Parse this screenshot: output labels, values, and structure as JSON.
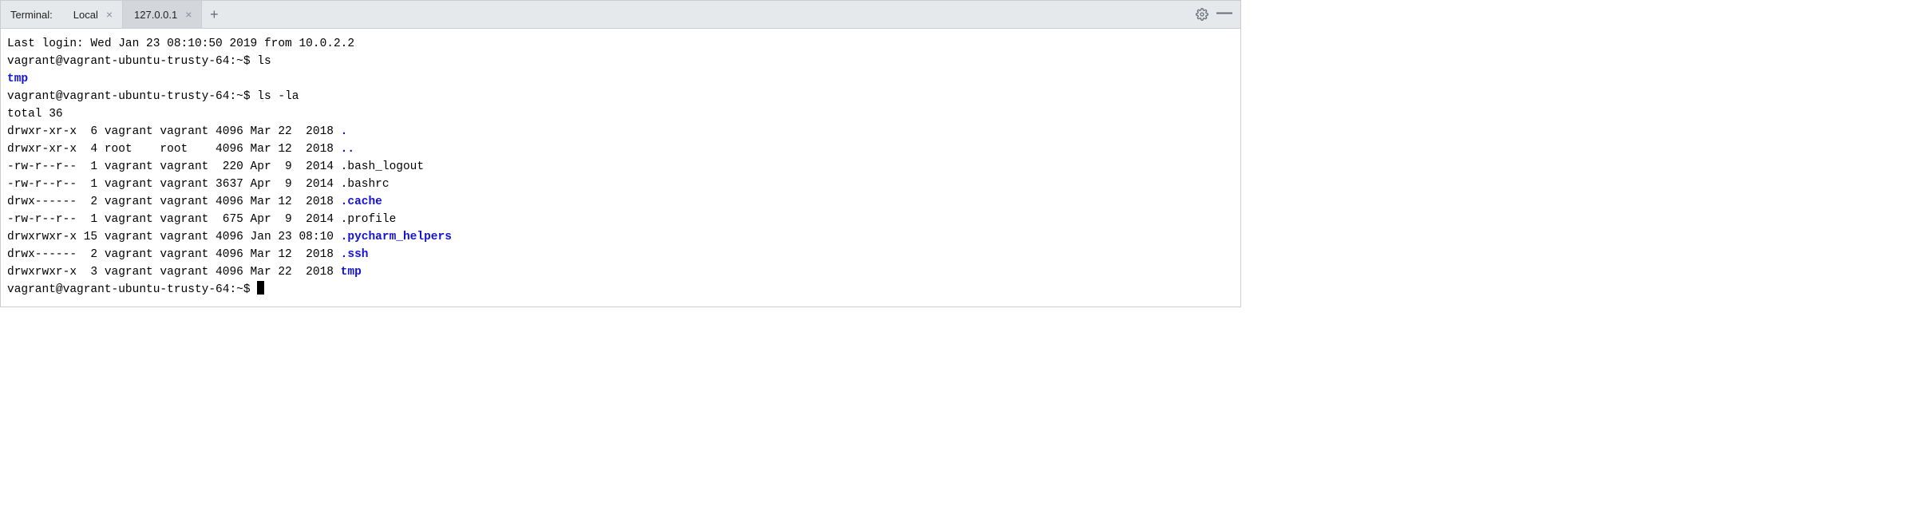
{
  "tabbar": {
    "title": "Terminal:",
    "tabs": [
      {
        "label": "Local",
        "active": false
      },
      {
        "label": "127.0.0.1",
        "active": true
      }
    ]
  },
  "terminal": {
    "last_login": "Last login: Wed Jan 23 08:10:50 2019 from 10.0.2.2",
    "prompt": "vagrant@vagrant-ubuntu-trusty-64:~$ ",
    "cmd1": "ls",
    "cmd1_out": "tmp",
    "cmd2": "ls -la",
    "total": "total 36",
    "listing": [
      {
        "pre": "drwxr-xr-x  6 vagrant vagrant 4096 Mar 22  2018 ",
        "name": ".",
        "dir": true
      },
      {
        "pre": "drwxr-xr-x  4 root    root    4096 Mar 12  2018 ",
        "name": "..",
        "dir": true
      },
      {
        "pre": "-rw-r--r--  1 vagrant vagrant  220 Apr  9  2014 ",
        "name": ".bash_logout",
        "dir": false
      },
      {
        "pre": "-rw-r--r--  1 vagrant vagrant 3637 Apr  9  2014 ",
        "name": ".bashrc",
        "dir": false
      },
      {
        "pre": "drwx------  2 vagrant vagrant 4096 Mar 12  2018 ",
        "name": ".cache",
        "dir": true
      },
      {
        "pre": "-rw-r--r--  1 vagrant vagrant  675 Apr  9  2014 ",
        "name": ".profile",
        "dir": false
      },
      {
        "pre": "drwxrwxr-x 15 vagrant vagrant 4096 Jan 23 08:10 ",
        "name": ".pycharm_helpers",
        "dir": true
      },
      {
        "pre": "drwx------  2 vagrant vagrant 4096 Mar 12  2018 ",
        "name": ".ssh",
        "dir": true
      },
      {
        "pre": "drwxrwxr-x  3 vagrant vagrant 4096 Mar 22  2018 ",
        "name": "tmp",
        "dir": true
      }
    ]
  }
}
